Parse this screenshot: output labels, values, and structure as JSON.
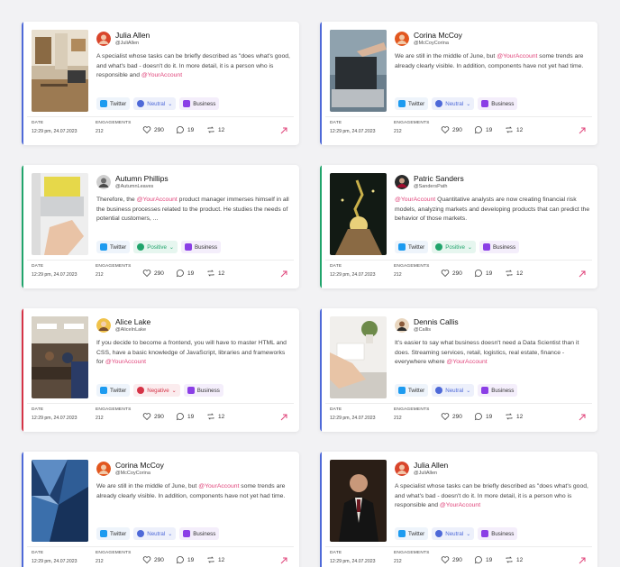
{
  "labels": {
    "date": "DATE",
    "engagements": "ENGAGEMENTS"
  },
  "colors": {
    "accent_neutral": "#4e69d8",
    "accent_positive": "#20a46b",
    "accent_negative": "#d53346",
    "mention": "#e0457b"
  },
  "cards": [
    {
      "name": "Julia Allen",
      "handle": "@JuliAllen",
      "text_before": "A specialist whose tasks can be briefly described as \"does what's good, and what's bad - doesn't do it. In more detail, it is a person who is responsible and ",
      "mention": "@YourAccount",
      "text_after": "",
      "network": "Twitter",
      "sentiment": "Neutral",
      "sentiment_class": "neutral",
      "category": "Business",
      "date": "12:29 pm, 24.07.2023",
      "engagements": "212",
      "likes": "290",
      "comments": "19",
      "reposts": "12",
      "thumb": "office-shelf",
      "avatar": "avatar-red"
    },
    {
      "name": "Corina McCoy",
      "handle": "@McCoyCorina",
      "text_before": "We are still in the middle of June, but ",
      "mention": "@YourAccount",
      "text_after": " some trends are already clearly visible. In addition, components have not yet had time.",
      "network": "Twitter",
      "sentiment": "Neutral",
      "sentiment_class": "neutral",
      "category": "Business",
      "date": "12:29 pm, 24.07.2023",
      "engagements": "212",
      "likes": "290",
      "comments": "19",
      "reposts": "12",
      "thumb": "laptop-hand",
      "avatar": "avatar-orange"
    },
    {
      "name": "Autumn Phillips",
      "handle": "@AutumnLeaves",
      "text_before": "Therefore, the ",
      "mention": "@YourAccount",
      "text_after": " product manager immerses himself in all the business processes related to the product. He studies the needs of potential customers, ...",
      "network": "Twitter",
      "sentiment": "Positive",
      "sentiment_class": "positive",
      "category": "Business",
      "date": "12:29 pm, 24.07.2023",
      "engagements": "212",
      "likes": "290",
      "comments": "19",
      "reposts": "12",
      "thumb": "laptop-desk",
      "avatar": "avatar-bw"
    },
    {
      "name": "Patric Sanders",
      "handle": "@SandersPath",
      "text_before": "",
      "mention": "@YourAccount",
      "text_after": " Quantitative analysts are now creating financial risk models, analyzing markets and developing products that can predict the behavior of those markets.",
      "network": "Twitter",
      "sentiment": "Positive",
      "sentiment_class": "positive",
      "category": "Business",
      "date": "12:29 pm, 24.07.2023",
      "engagements": "212",
      "likes": "290",
      "comments": "19",
      "reposts": "12",
      "thumb": "plant-hands",
      "avatar": "avatar-dark"
    },
    {
      "name": "Alice Lake",
      "handle": "@AliceInLake",
      "text_before": "If you decide to become a frontend, you will have to master HTML and CSS, have a basic knowledge of JavaScript, libraries and frameworks for ",
      "mention": "@YourAccount",
      "text_after": "",
      "network": "Twitter",
      "sentiment": "Negative",
      "sentiment_class": "negative",
      "category": "Business",
      "date": "12:29 pm, 24.07.2023",
      "engagements": "212",
      "likes": "290",
      "comments": "19",
      "reposts": "12",
      "thumb": "meeting",
      "avatar": "avatar-yellow"
    },
    {
      "name": "Dennis Callis",
      "handle": "@Callis",
      "text_before": "It's easier to say what business doesn't need a Data Scientist than it does. Streaming services, retail, logistics, real estate, finance - everywhere where ",
      "mention": "@YourAccount",
      "text_after": "",
      "network": "Twitter",
      "sentiment": "Neutral",
      "sentiment_class": "neutral",
      "category": "Business",
      "date": "12:29 pm, 24.07.2023",
      "engagements": "212",
      "likes": "290",
      "comments": "19",
      "reposts": "12",
      "thumb": "desk-plant",
      "avatar": "avatar-brown"
    },
    {
      "name": "Corina McCoy",
      "handle": "@McCoyCorina",
      "text_before": "We are still in the middle of June, but ",
      "mention": "@YourAccount",
      "text_after": " some trends are already clearly visible. In addition, components have not yet had time.",
      "network": "Twitter",
      "sentiment": "Neutral",
      "sentiment_class": "neutral",
      "category": "Business",
      "date": "12:29 pm, 24.07.2023",
      "engagements": "212",
      "likes": "290",
      "comments": "19",
      "reposts": "12",
      "thumb": "glass-building",
      "avatar": "avatar-orange"
    },
    {
      "name": "Julia Allen",
      "handle": "@JuliAllen",
      "text_before": "A specialist whose tasks can be briefly described as \"does what's good, and what's bad - doesn't do it. In more detail, it is a person who is responsible and ",
      "mention": "@YourAccount",
      "text_after": "",
      "network": "Twitter",
      "sentiment": "Neutral",
      "sentiment_class": "neutral",
      "category": "Business",
      "date": "12:29 pm, 24.07.2023",
      "engagements": "212",
      "likes": "290",
      "comments": "19",
      "reposts": "12",
      "thumb": "man-suit",
      "avatar": "avatar-red"
    }
  ]
}
